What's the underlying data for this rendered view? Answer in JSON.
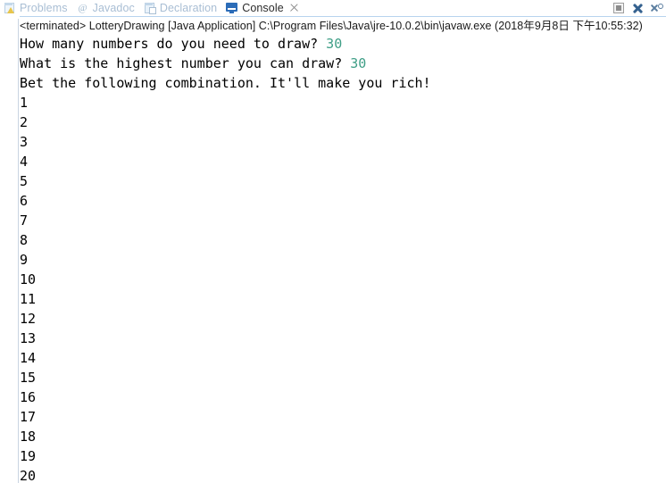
{
  "window": {
    "app": "Eclipse IDE",
    "view": "Console"
  },
  "tabs": [
    {
      "label": "Problems",
      "icon": "problems-icon",
      "active": false,
      "closable": false
    },
    {
      "label": "Javadoc",
      "icon": "javadoc-icon",
      "active": false,
      "closable": false
    },
    {
      "label": "Declaration",
      "icon": "declaration-icon",
      "active": false,
      "closable": false
    },
    {
      "label": "Console",
      "icon": "console-icon",
      "active": true,
      "closable": true
    }
  ],
  "toolbar": {
    "buttons": [
      {
        "name": "terminate-button",
        "icon": "stop-square-icon",
        "enabled": false
      },
      {
        "name": "remove-all-terminated-button",
        "icon": "close-x-icon",
        "enabled": true
      },
      {
        "name": "remove-launch-button",
        "icon": "close-x-small-icon",
        "enabled": true
      }
    ]
  },
  "status": {
    "text": "<terminated> LotteryDrawing [Java Application] C:\\Program Files\\Java\\jre-10.0.2\\bin\\javaw.exe (2018年9月8日 下午10:55:32)",
    "state": "<terminated>",
    "launch_config": "LotteryDrawing",
    "launch_type": "Java Application",
    "vm_path": "C:\\Program Files\\Java\\jre-10.0.2\\bin\\javaw.exe",
    "timestamp": "2018年9月8日 下午10:55:32"
  },
  "console": {
    "colors": {
      "stdout": "#000000",
      "stdin_echo": "#3e9e86",
      "background": "#ffffff"
    },
    "lines": [
      {
        "type": "prompt",
        "text": "How many numbers do you need to draw? ",
        "echo": "30"
      },
      {
        "type": "prompt",
        "text": "What is the highest number you can draw? ",
        "echo": "30"
      },
      {
        "type": "out",
        "text": "Bet the following combination. It'll make you rich!",
        "echo": ""
      },
      {
        "type": "out",
        "text": "1",
        "echo": ""
      },
      {
        "type": "out",
        "text": "2",
        "echo": ""
      },
      {
        "type": "out",
        "text": "3",
        "echo": ""
      },
      {
        "type": "out",
        "text": "4",
        "echo": ""
      },
      {
        "type": "out",
        "text": "5",
        "echo": ""
      },
      {
        "type": "out",
        "text": "6",
        "echo": ""
      },
      {
        "type": "out",
        "text": "7",
        "echo": ""
      },
      {
        "type": "out",
        "text": "8",
        "echo": ""
      },
      {
        "type": "out",
        "text": "9",
        "echo": ""
      },
      {
        "type": "out",
        "text": "10",
        "echo": ""
      },
      {
        "type": "out",
        "text": "11",
        "echo": ""
      },
      {
        "type": "out",
        "text": "12",
        "echo": ""
      },
      {
        "type": "out",
        "text": "13",
        "echo": ""
      },
      {
        "type": "out",
        "text": "14",
        "echo": ""
      },
      {
        "type": "out",
        "text": "15",
        "echo": ""
      },
      {
        "type": "out",
        "text": "16",
        "echo": ""
      },
      {
        "type": "out",
        "text": "17",
        "echo": ""
      },
      {
        "type": "out",
        "text": "18",
        "echo": ""
      },
      {
        "type": "out",
        "text": "19",
        "echo": ""
      },
      {
        "type": "out",
        "text": "20",
        "echo": ""
      }
    ]
  }
}
